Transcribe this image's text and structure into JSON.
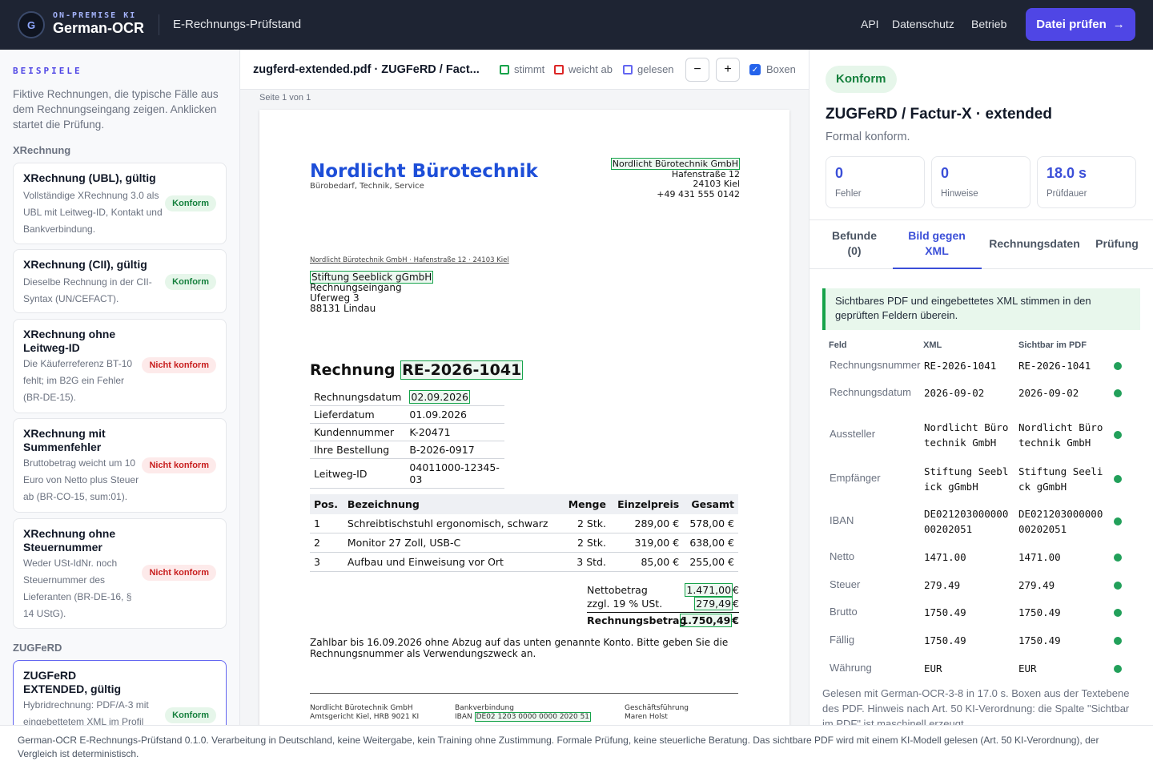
{
  "header": {
    "logo_letter": "G",
    "brand_sub": "ON-PREMISE KI",
    "brand": "German-OCR",
    "subtitle": "E-Rechnungs-Prüfstand",
    "nav": [
      "API",
      "Datenschutz",
      "Betrieb"
    ],
    "cta": "Datei prüfen",
    "cta_icon": "→"
  },
  "sidebar": {
    "heading": "BEISPIELE",
    "intro": "Fiktive Rechnungen, die typische Fälle aus dem Rechnungseingang zeigen. Anklicken startet die Prüfung.",
    "group1": "XRechnung",
    "group2": "ZUGFeRD",
    "cards": [
      {
        "title": "XRechnung (UBL), gültig",
        "desc": "Vollständige XRechnung 3.0 als UBL mit Leitweg-ID, Kontakt und Bankverbindung.",
        "badge": "Konform"
      },
      {
        "title": "XRechnung (CII), gültig",
        "desc": "Dieselbe Rechnung in der CII-Syntax (UN/CEFACT).",
        "badge": "Konform"
      },
      {
        "title": "XRechnung ohne Leitweg-ID",
        "desc": "Die Käuferreferenz BT-10 fehlt; im B2G ein Fehler (BR-DE-15).",
        "badge": "Nicht konform"
      },
      {
        "title": "XRechnung mit Summenfehler",
        "desc": "Bruttobetrag weicht um 10 Euro von Netto plus Steuer ab (BR-CO-15, sum:01).",
        "badge": "Nicht konform"
      },
      {
        "title": "XRechnung ohne Steuernummer",
        "desc": "Weder USt-IdNr. noch Steuernummer des Lieferanten (BR-DE-16, § 14 UStG).",
        "badge": "Nicht konform"
      },
      {
        "title": "ZUGFeRD EXTENDED, gültig",
        "desc": "Hybridrechnung: PDF/A-3 mit eingebettetem XML im Profil",
        "badge": "Konform"
      }
    ]
  },
  "viewer": {
    "file": "zugferd-extended.pdf · ZUGFeRD / Fact...",
    "legend": {
      "match": "stimmt",
      "diff": "weicht ab",
      "read": "gelesen"
    },
    "zoom_out": "−",
    "zoom_in": "+",
    "boxes_label": "Boxen",
    "boxes_checked": true,
    "page_label": "Seite 1 von 1",
    "doc": {
      "company": "Nordlicht Bürotechnik",
      "tagline": "Bürobedarf, Technik, Service",
      "sender_name": "Nordlicht Bürotechnik GmbH",
      "sender_lines": [
        "Hafenstraße 12",
        "24103 Kiel",
        "+49 431 555 0142"
      ],
      "return_line": "Nordlicht Bürotechnik GmbH · Hafenstraße 12 · 24103 Kiel",
      "recipient_name": "Stiftung Seeblick gGmbH",
      "recipient_lines": [
        "Rechnungseingang",
        "Uferweg 3",
        "88131 Lindau"
      ],
      "heading": "Rechnung",
      "number": "RE-2026-1041",
      "meta": [
        [
          "Rechnungsdatum",
          "02.09.2026"
        ],
        [
          "Lieferdatum",
          "01.09.2026"
        ],
        [
          "Kundennummer",
          "K-20471"
        ],
        [
          "Ihre Bestellung",
          "B-2026-0917"
        ],
        [
          "Leitweg-ID",
          "04011000-12345-03"
        ]
      ],
      "pos_headers": [
        "Pos.",
        "Bezeichnung",
        "Menge",
        "Einzelpreis",
        "Gesamt"
      ],
      "positions": [
        [
          "1",
          "Schreibtischstuhl ergonomisch, schwarz",
          "2 Stk.",
          "289,00 €",
          "578,00 €"
        ],
        [
          "2",
          "Monitor 27 Zoll, USB-C",
          "2 Stk.",
          "319,00 €",
          "638,00 €"
        ],
        [
          "3",
          "Aufbau und Einweisung vor Ort",
          "3 Std.",
          "85,00 €",
          "255,00 €"
        ]
      ],
      "net_label": "Nettobetrag",
      "net_value": "1.471,00",
      "tax_label": "zzgl. 19 % USt.",
      "tax_value": "279,49",
      "total_label": "Rechnungsbetrag",
      "total_value": "1.750,49",
      "currency": "€",
      "payment": "Zahlbar bis 16.09.2026 ohne Abzug auf das unten genannte Konto. Bitte geben Sie die Rechnungsnummer als Verwendungszweck an.",
      "foot_col1": [
        "Nordlicht Bürotechnik GmbH",
        "Amtsgericht Kiel, HRB 9021 KI"
      ],
      "foot_col2_title": "Bankverbindung",
      "foot_col2_label": "IBAN",
      "foot_iban": "DE02 1203 0000 0000 2020 51",
      "foot_col3": [
        "Geschäftsführung",
        "Maren Holst"
      ]
    }
  },
  "result": {
    "badge": "Konform",
    "title": "ZUGFeRD / Factur-X · extended",
    "subtitle": "Formal konform.",
    "stats": [
      {
        "value": "0",
        "label": "Fehler"
      },
      {
        "value": "0",
        "label": "Hinweise"
      },
      {
        "value": "18.0 s",
        "label": "Prüfdauer"
      }
    ],
    "tabs": [
      "Befunde (0)",
      "Bild gegen XML",
      "Rechnungsdaten",
      "Prüfung"
    ],
    "active_tab": "Bild gegen XML",
    "info": "Sichtbares PDF und eingebettetes XML stimmen in den geprüften Feldern überein.",
    "cols": [
      "Feld",
      "XML",
      "Sichtbar im PDF"
    ],
    "rows": [
      {
        "field": "Rechnungsnummer",
        "xml": "RE-2026-1041",
        "pdf": "RE-2026-1041"
      },
      {
        "field": "Rechnungsdatum",
        "xml": "2026-09-02",
        "pdf": "2026-09-02"
      },
      {
        "field": "Aussteller",
        "xml": "Nordlicht Bürotechnik GmbH",
        "pdf": "Nordlicht Bürotechnik GmbH"
      },
      {
        "field": "Empfänger",
        "xml": "Stiftung Seeblick gGmbH",
        "pdf": "Stiftung Seelick gGmbH"
      },
      {
        "field": "IBAN",
        "xml": "DE02120300000000202051",
        "pdf": "DE02120300000000202051"
      },
      {
        "field": "Netto",
        "xml": "1471.00",
        "pdf": "1471.00"
      },
      {
        "field": "Steuer",
        "xml": "279.49",
        "pdf": "279.49"
      },
      {
        "field": "Brutto",
        "xml": "1750.49",
        "pdf": "1750.49"
      },
      {
        "field": "Fällig",
        "xml": "1750.49",
        "pdf": "1750.49"
      },
      {
        "field": "Währung",
        "xml": "EUR",
        "pdf": "EUR"
      }
    ],
    "note": "Gelesen mit German-OCR-3-8 in 17.0 s. Boxen aus der Textebene des PDF. Hinweis nach Art. 50 KI-Verordnung: die Spalte \"Sichtbar im PDF\" ist maschinell erzeugt."
  },
  "footer": "German-OCR E-Rechnungs-Prüfstand 0.1.0. Verarbeitung in Deutschland, keine Weitergabe, kein Training ohne Zustimmung. Formale Prüfung, keine steuerliche Beratung. Das sichtbare PDF wird mit einem KI-Modell gelesen (Art. 50 KI-Verordnung), der Vergleich ist deterministisch.",
  "colors": {
    "accent": "#4f46e5",
    "match": "#16a34a",
    "diff": "#dc2626",
    "read": "#6366f1",
    "topbar": "#1e2433"
  }
}
